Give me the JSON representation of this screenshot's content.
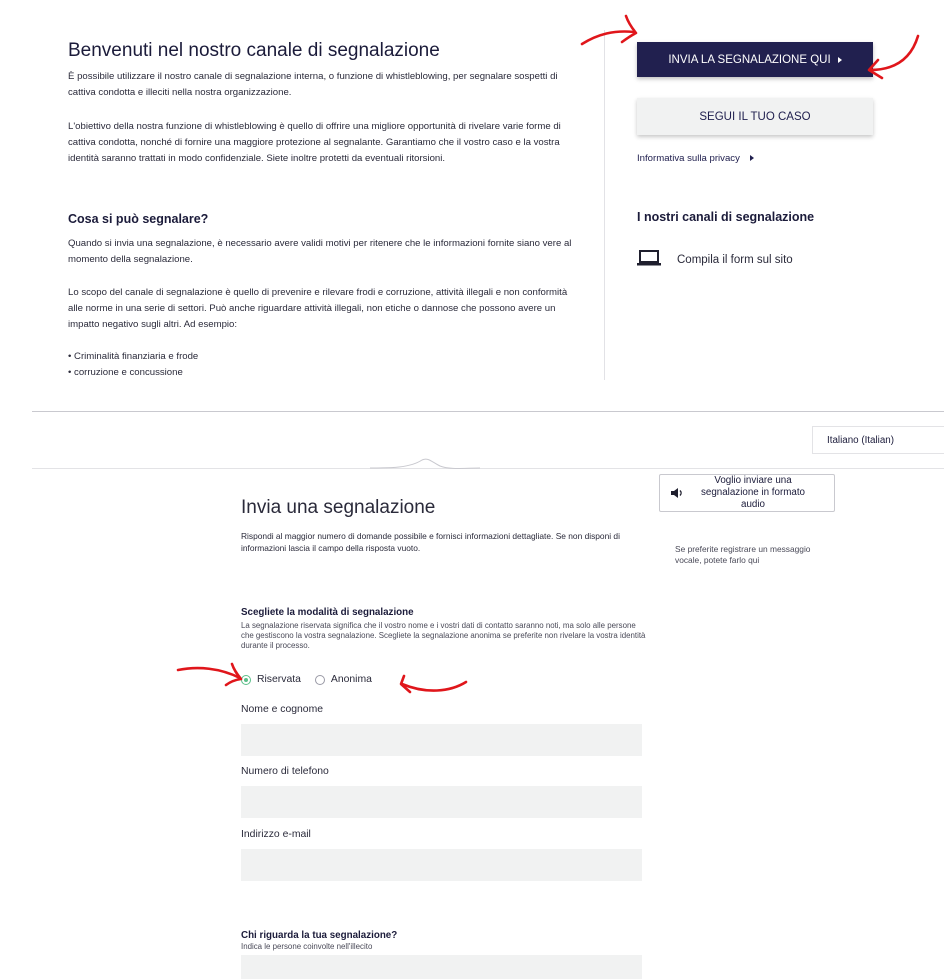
{
  "top": {
    "title": "Benvenuti nel nostro canale di segnalazione",
    "intro_p1": "È possibile utilizzare il nostro canale di segnalazione interna, o funzione di whistleblowing, per segnalare sospetti di cattiva condotta e illeciti nella nostra organizzazione.",
    "intro_p2": "L'obiettivo della nostra funzione di whistleblowing è quello di offrire una migliore opportunità di rivelare varie forme di cattiva condotta, nonché di fornire una maggiore protezione al segnalante. Garantiamo che il vostro caso e la vostra identità saranno trattati in modo confidenziale. Siete inoltre protetti da eventuali ritorsioni.",
    "cosa_title": "Cosa si può segnalare?",
    "cosa_p1": "Quando si invia una segnalazione, è necessario avere validi motivi per ritenere che le informazioni fornite siano vere al momento della segnalazione.",
    "cosa_p2": "Lo scopo del canale di segnalazione è quello di prevenire e rilevare frodi e corruzione, attività illegali e non conformità alle norme in una serie di settori. Può anche riguardare attività illegali, non etiche o dannose che possono avere un impatto negativo sugli altri. Ad esempio:",
    "bullets": [
      "• Criminalità finanziaria e frode",
      "• corruzione e concussione"
    ]
  },
  "sidebar": {
    "invia_label": "INVIA LA SEGNALAZIONE QUI",
    "segui_label": "SEGUI IL TUO CASO",
    "privacy_label": "Informativa sulla privacy",
    "canali_title": "I nostri canali di segnalazione",
    "form_channel_label": "Compila il form sul sito"
  },
  "language": {
    "selected": "Italiano (Italian)"
  },
  "form": {
    "title": "Invia una segnalazione",
    "intro": "Rispondi al maggior numero di domande possibile e fornisci informazioni dettagliate. Se non disponi di informazioni lascia il campo della risposta vuoto.",
    "audio_button": "Voglio inviare una segnalazione in formato audio",
    "audio_note": "Se preferite registrare un messaggio vocale, potete farlo qui",
    "mode_title": "Scegliete la modalità di segnalazione",
    "mode_desc": "La segnalazione riservata significa che il vostro nome e i vostri dati di contatto saranno noti, ma solo alle persone che gestiscono la vostra segnalazione. Scegliete la segnalazione anonima se preferite non rivelare la vostra identità durante il processo.",
    "option_riservata": "Riservata",
    "option_anonima": "Anonima",
    "selected_option": "Riservata",
    "name_label": "Nome e cognome",
    "name_value": "",
    "phone_label": "Numero di telefono",
    "phone_value": "",
    "email_label": "Indirizzo e-mail",
    "email_value": "",
    "chi_title": "Chi riguarda la tua segnalazione?",
    "chi_desc": "Indica le persone coinvolte nell'illecito",
    "chi_value": ""
  },
  "colors": {
    "primary_navy": "#21204f",
    "secondary_button": "#f1f2f2",
    "annotation_arrow": "#e0161b",
    "radio_selected": "#5bbf89"
  },
  "icons": [
    "chevron-right-icon",
    "laptop-icon",
    "speaker-icon",
    "red-arrow-annotation"
  ]
}
